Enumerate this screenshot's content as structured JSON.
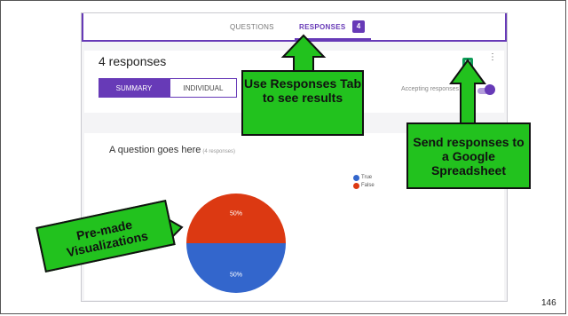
{
  "tabs": {
    "questions_label": "QUESTIONS",
    "responses_label": "RESPONSES",
    "responses_count": "4"
  },
  "header": {
    "responses_title": "4 responses",
    "summary_label": "SUMMARY",
    "individual_label": "INDIVIDUAL",
    "accepting_label": "Accepting responses",
    "sheets_icon": "google-sheets-icon",
    "more_icon": "more-vert-icon"
  },
  "question": {
    "title": "A question goes here",
    "count": "(4 responses)"
  },
  "chart_data": {
    "type": "pie",
    "categories": [
      "True",
      "False"
    ],
    "values": [
      50,
      50
    ],
    "labels": [
      "50%",
      "50%"
    ],
    "colors": [
      "#3366cc",
      "#dc3912"
    ],
    "legend_position": "right"
  },
  "callouts": {
    "responses_tab": "Use Responses Tab to see results",
    "spreadsheet": "Send responses to a Google Spreadsheet",
    "visualizations": "Pre-made Visualizations"
  },
  "colors": {
    "accent": "#673ab7",
    "callout_green": "#22c21e"
  },
  "page_number": "146"
}
